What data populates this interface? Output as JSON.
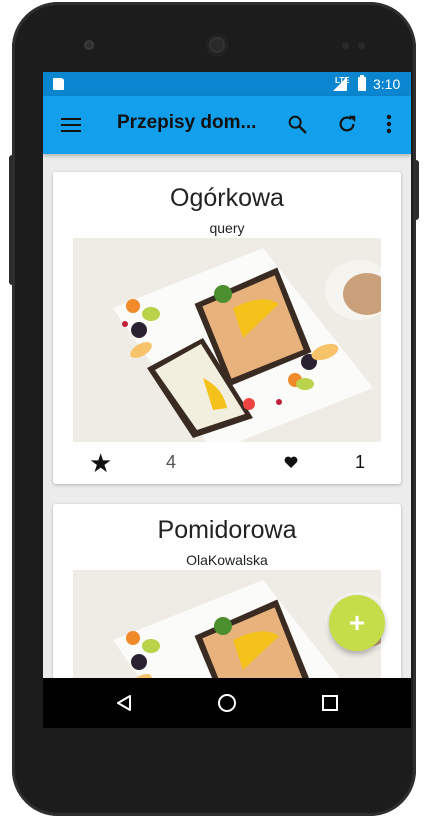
{
  "status_bar": {
    "network_label": "LTE",
    "time": "3:10",
    "icons": [
      "sd-card-icon",
      "signal-icon",
      "battery-icon"
    ]
  },
  "app_bar": {
    "title": "Przepisy dom...",
    "actions": [
      "menu-icon",
      "search-icon",
      "refresh-icon",
      "more-vert-icon"
    ]
  },
  "recipes": [
    {
      "title": "Ogórkowa",
      "author": "query",
      "stars": "4",
      "likes": "1"
    },
    {
      "title": "Pomidorowa",
      "author": "OlaKowalska"
    }
  ],
  "fab": {
    "label": "+"
  },
  "nav_bar": {
    "icons": [
      "back-icon",
      "home-icon",
      "recents-icon"
    ]
  },
  "colors": {
    "status_bar": "#0a86d1",
    "app_bar": "#129fec",
    "fab": "#c6dd4a",
    "background": "#ececec"
  }
}
